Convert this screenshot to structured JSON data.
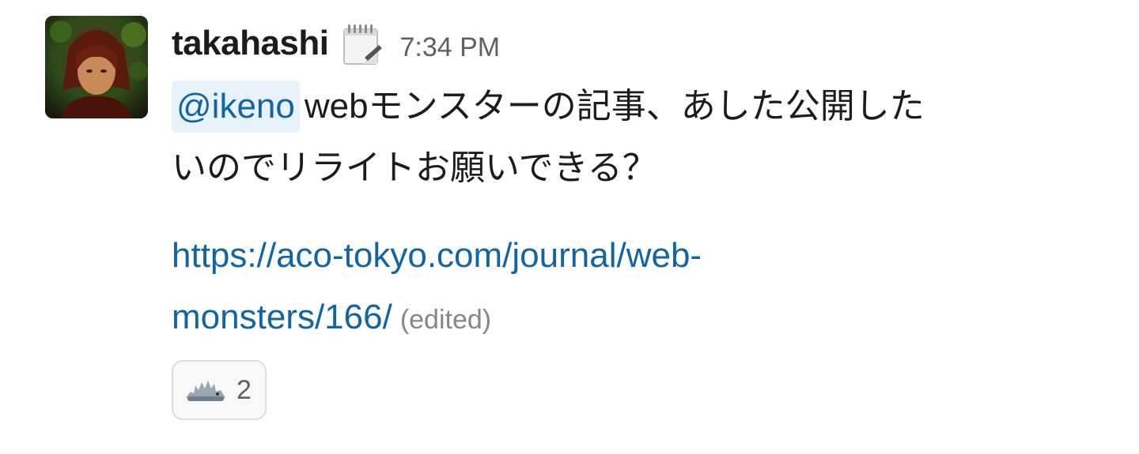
{
  "message": {
    "username": "takahashi",
    "status_emoji": "spiral-notepad-icon",
    "timestamp": "7:34 PM",
    "mention": "@ikeno",
    "text_line1": "webモンスターの記事、あした公開した",
    "text_line2": "いのでリライトお願いできる？",
    "link_line1": "https://aco-tokyo.com/journal/web-",
    "link_line2": "monsters/166/",
    "edited_label": "(edited)",
    "reaction": {
      "emoji": "monster-emoji-icon",
      "count": "2"
    }
  },
  "colors": {
    "link": "#1264a3",
    "mention_bg": "#e8f2fa",
    "meta_text": "#616061"
  }
}
